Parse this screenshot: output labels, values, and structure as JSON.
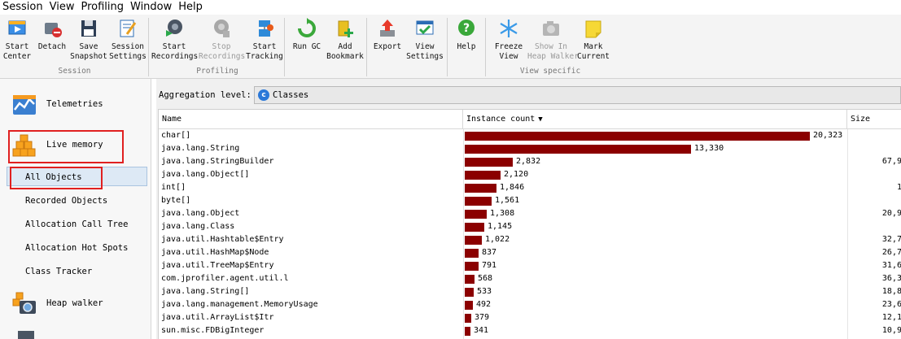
{
  "menu": [
    "Session",
    "View",
    "Profiling",
    "Window",
    "Help"
  ],
  "toolbar": {
    "groups": [
      {
        "label": "Session",
        "buttons": [
          {
            "label": "Start\nCenter",
            "icon": "start-center-icon"
          },
          {
            "label": "Detach",
            "icon": "detach-icon"
          },
          {
            "label": "Save\nSnapshot",
            "icon": "save-snapshot-icon"
          },
          {
            "label": "Session\nSettings",
            "icon": "session-settings-icon"
          }
        ]
      },
      {
        "label": "Profiling",
        "buttons": [
          {
            "label": "Start\nRecordings",
            "icon": "start-recordings-icon"
          },
          {
            "label": "Stop\nRecordings",
            "icon": "stop-recordings-icon",
            "disabled": true
          },
          {
            "label": "Start\nTracking",
            "icon": "start-tracking-icon"
          }
        ]
      },
      {
        "label": "",
        "buttons": [
          {
            "label": "Run GC",
            "icon": "run-gc-icon"
          },
          {
            "label": "Add\nBookmark",
            "icon": "add-bookmark-icon"
          }
        ]
      },
      {
        "label": "",
        "buttons": [
          {
            "label": "Export",
            "icon": "export-icon"
          },
          {
            "label": "View\nSettings",
            "icon": "view-settings-icon"
          }
        ]
      },
      {
        "label": "",
        "buttons": [
          {
            "label": "Help",
            "icon": "help-icon"
          }
        ]
      },
      {
        "label": "View specific",
        "buttons": [
          {
            "label": "Freeze\nView",
            "icon": "freeze-view-icon"
          },
          {
            "label": "Show In\nHeap Walker",
            "icon": "show-in-heap-walker-icon",
            "disabled": true
          },
          {
            "label": "Mark\nCurrent",
            "icon": "mark-current-icon"
          }
        ]
      }
    ]
  },
  "sidebar": {
    "telemetries": "Telemetries",
    "live_memory": "Live memory",
    "sub_items": [
      "All Objects",
      "Recorded Objects",
      "Allocation Call Tree",
      "Allocation Hot Spots",
      "Class Tracker"
    ],
    "heap_walker": "Heap walker"
  },
  "aggregation": {
    "label": "Aggregation level:",
    "value": "Classes"
  },
  "table": {
    "headers": {
      "name": "Name",
      "count": "Instance count",
      "size": "Size"
    },
    "max_count": 20323,
    "rows": [
      {
        "name": "char[]",
        "count": 20323,
        "count_label": "20,323",
        "size": ""
      },
      {
        "name": "java.lang.String",
        "count": 13330,
        "count_label": "13,330",
        "size": ""
      },
      {
        "name": "java.lang.StringBuilder",
        "count": 2832,
        "count_label": "2,832",
        "size": "67,9"
      },
      {
        "name": "java.lang.Object[]",
        "count": 2120,
        "count_label": "2,120",
        "size": ""
      },
      {
        "name": "int[]",
        "count": 1846,
        "count_label": "1,846",
        "size": "1"
      },
      {
        "name": "byte[]",
        "count": 1561,
        "count_label": "1,561",
        "size": ""
      },
      {
        "name": "java.lang.Object",
        "count": 1308,
        "count_label": "1,308",
        "size": "20,9"
      },
      {
        "name": "java.lang.Class",
        "count": 1145,
        "count_label": "1,145",
        "size": ""
      },
      {
        "name": "java.util.Hashtable$Entry",
        "count": 1022,
        "count_label": "1,022",
        "size": "32,7"
      },
      {
        "name": "java.util.HashMap$Node",
        "count": 837,
        "count_label": "837",
        "size": "26,7"
      },
      {
        "name": "java.util.TreeMap$Entry",
        "count": 791,
        "count_label": "791",
        "size": "31,6"
      },
      {
        "name": "com.jprofiler.agent.util.l",
        "count": 568,
        "count_label": "568",
        "size": "36,3"
      },
      {
        "name": "java.lang.String[]",
        "count": 533,
        "count_label": "533",
        "size": "18,8"
      },
      {
        "name": "java.lang.management.MemoryUsage",
        "count": 492,
        "count_label": "492",
        "size": "23,6"
      },
      {
        "name": "java.util.ArrayList$Itr",
        "count": 379,
        "count_label": "379",
        "size": "12,1"
      },
      {
        "name": "sun.misc.FDBigInteger",
        "count": 341,
        "count_label": "341",
        "size": "10,9"
      }
    ]
  },
  "colors": {
    "bar": "#8b0000",
    "highlight": "#e02020",
    "selection": "#dde9f5"
  }
}
